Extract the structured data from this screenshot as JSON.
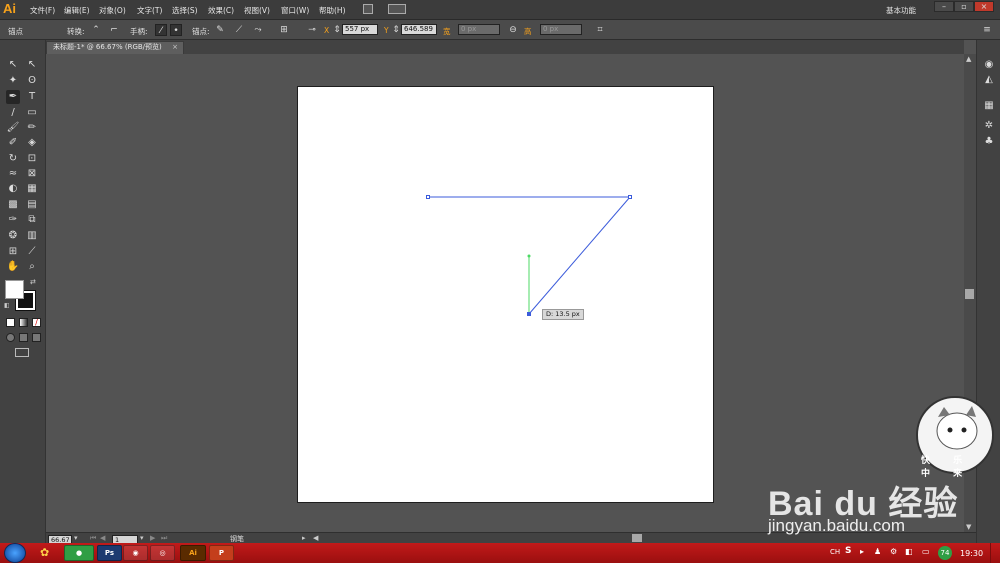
{
  "app": {
    "logo": "Ai",
    "workspace": "基本功能"
  },
  "menu": [
    "文件(F)",
    "编辑(E)",
    "对象(O)",
    "文字(T)",
    "选择(S)",
    "效果(C)",
    "视图(V)",
    "窗口(W)",
    "帮助(H)"
  ],
  "control_bar": {
    "mode_label": "锚点",
    "convert_label": "转换:",
    "handles_label": "手柄:",
    "anchor_label": "锚点:",
    "x_label": "X",
    "x_value": "557 px",
    "y_label": "Y",
    "y_value": "646.589",
    "w_label": "宽",
    "w_value": "0 px",
    "h_label": "高",
    "h_value": "0 px"
  },
  "document_tab": {
    "title": "未标题-1* @ 66.67% (RGB/预览)",
    "close": "×"
  },
  "status_bar": {
    "zoom": "66.67",
    "artboard_number": "1",
    "tool_name": "钢笔"
  },
  "canvas": {
    "tooltip": "D: 13.5 px",
    "path_color": "#3b5bdb",
    "handle_color": "#4cd964"
  },
  "taskbar": {
    "apps": [
      "Ps",
      "Ai",
      "P"
    ],
    "ime": "CH",
    "badge": "74",
    "clock": "19:30"
  },
  "watermark": {
    "brand": "Bai du 经验",
    "url": "jingyan.baidu.com",
    "mascot_text": "快 乐 中 来"
  },
  "colors": {
    "accent": "#f7a21b",
    "panel": "#424242",
    "canvas": "#535353",
    "taskbar": "#b01515"
  }
}
